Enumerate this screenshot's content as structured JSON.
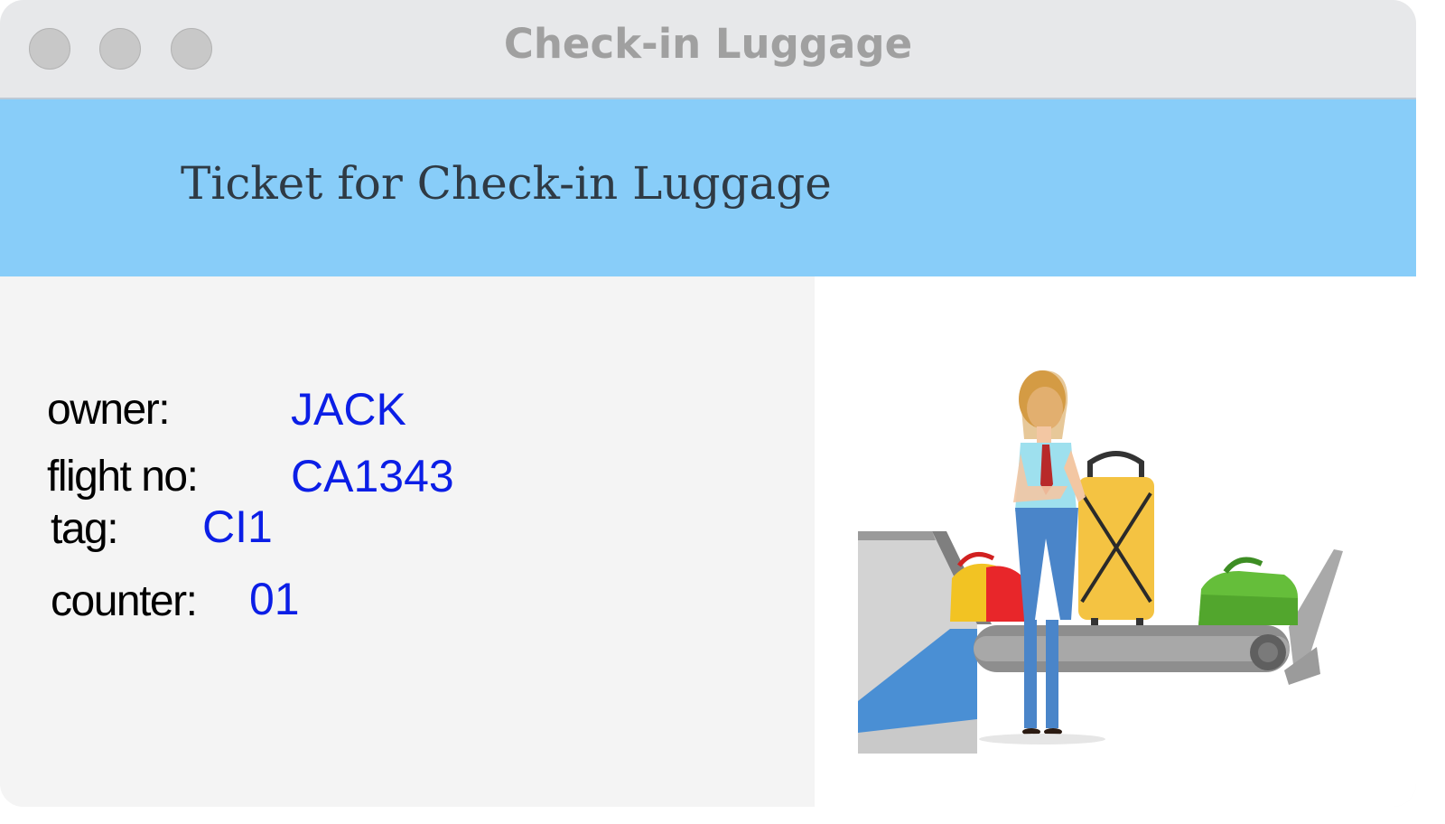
{
  "window": {
    "title": "Check-in Luggage"
  },
  "banner": {
    "title": "Ticket for Check-in Luggage"
  },
  "ticket": {
    "owner_label": "owner:",
    "owner_value": "JACK",
    "flight_label": "flight no:",
    "flight_value": "CA1343",
    "tag_label": "tag:",
    "tag_value": "CI1",
    "counter_label": "counter:",
    "counter_value": "01"
  },
  "colors": {
    "banner_bg": "#88cdf9",
    "value_text": "#0b1ee6",
    "titlebar_bg": "#e7e8ea"
  }
}
